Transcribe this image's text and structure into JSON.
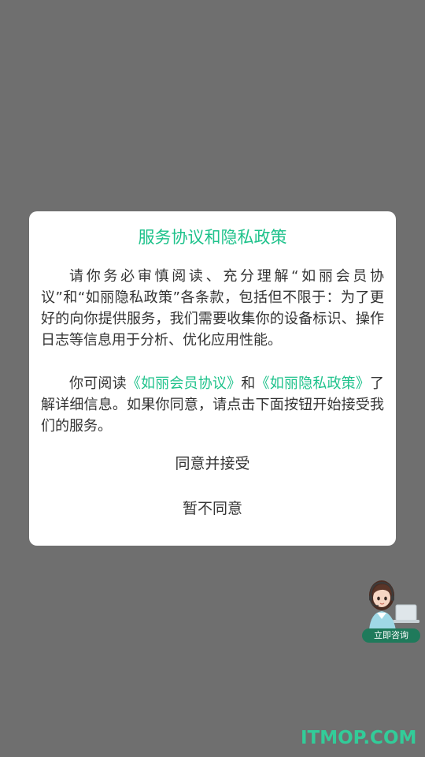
{
  "dialog": {
    "title": "服务协议和隐私政策",
    "para1": "请你务必审慎阅读、充分理解“如丽会员协议”和“如丽隐私政策”各条款，包括但不限于：为了更好的向你提供服务，我们需要收集你的设备标识、操作日志等信息用于分析、优化应用性能。",
    "para2_prefix": "你可阅读",
    "link_member": "《如丽会员协议》",
    "para2_and": "和",
    "link_privacy": "《如丽隐私政策》",
    "para2_suffix": "了解详细信息。如果你同意，请点击下面按钮开始接受我们的服务。",
    "accept_label": "同意并接受",
    "decline_label": "暂不同意"
  },
  "consult": {
    "label": "立即咨询",
    "icon": "customer-service-avatar-icon"
  },
  "watermark": "ITMOP.COM",
  "colors": {
    "accent": "#1ec28b",
    "overlay": "#6f6f6f",
    "text": "#333333"
  }
}
